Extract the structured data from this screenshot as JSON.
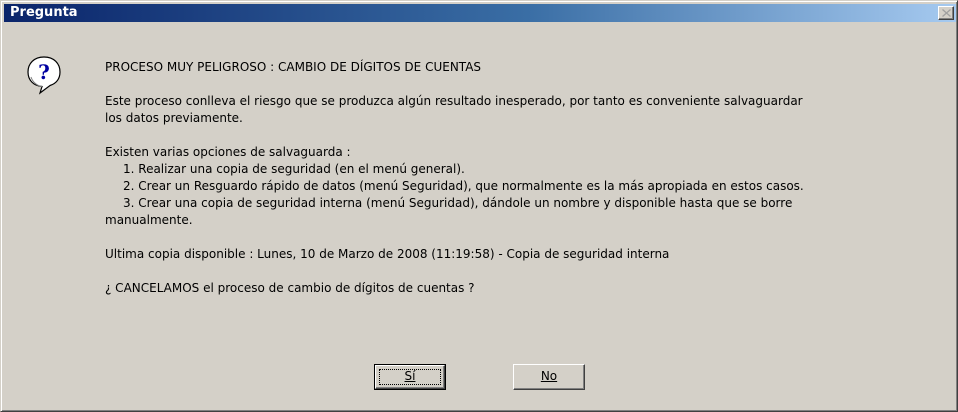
{
  "window": {
    "title": "Pregunta"
  },
  "icons": {
    "question": "question-balloon-icon",
    "close": "close-icon"
  },
  "message": {
    "heading": "PROCESO MUY PELIGROSO : CAMBIO DE DÍGITOS DE CUENTAS",
    "intro_line1": "Este proceso conlleva el riesgo que se produzca algún resultado inesperado, por tanto es conveniente salvaguardar",
    "intro_line2": "los datos previamente.",
    "options_title": "Existen varias opciones de salvaguarda :",
    "option1": "1. Realizar una copia de seguridad (en el menú general).",
    "option2": "2. Crear un Resguardo rápido de datos (menú Seguridad), que normalmente es la más apropiada en estos casos.",
    "option3_line1": "3. Crear una copia de seguridad interna (menú Seguridad), dándole un nombre y disponible hasta que se borre",
    "option3_line2": "manualmente.",
    "last_copy": "Ultima copia disponible : Lunes, 10 de Marzo de 2008 (11:19:58) - Copia de seguridad interna",
    "question": "¿ CANCELAMOS el proceso de cambio de dígitos de cuentas ?"
  },
  "buttons": {
    "yes_label": "Sí",
    "no_label": "No"
  },
  "colors": {
    "titlebar_start": "#0a246a",
    "titlebar_end": "#a6caf0",
    "face": "#d4d0c8"
  }
}
